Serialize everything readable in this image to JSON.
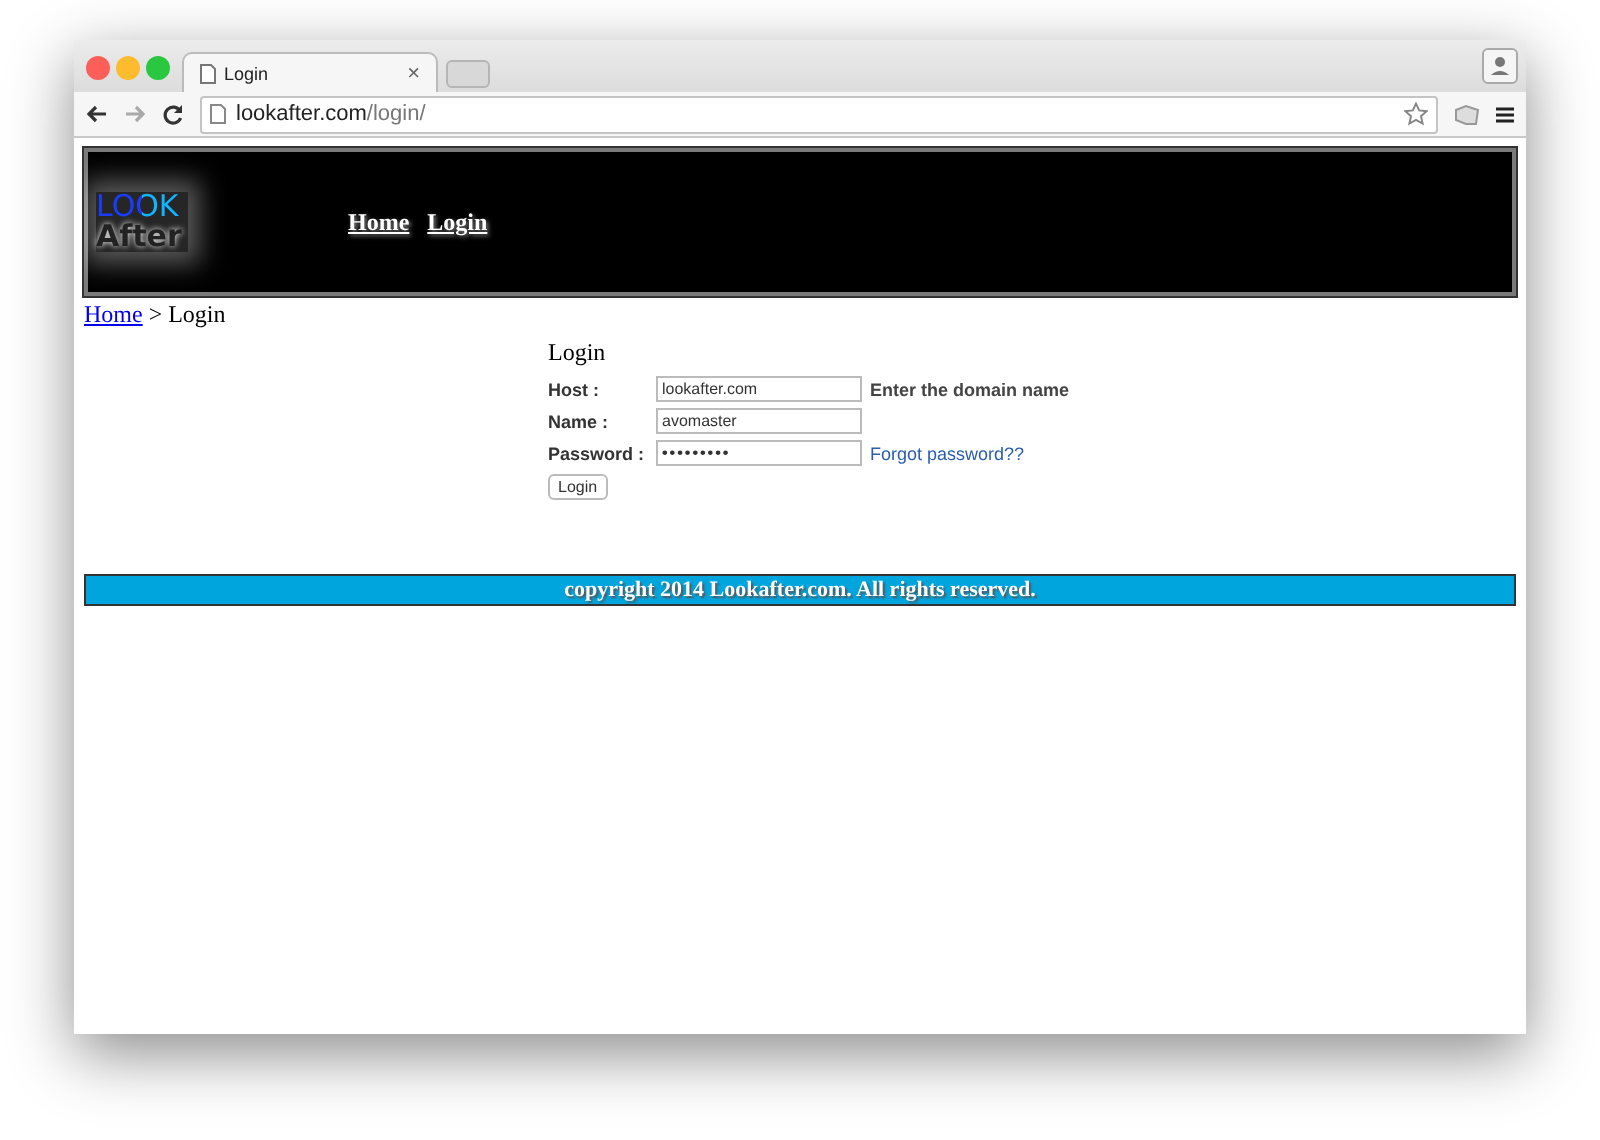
{
  "browser": {
    "tab": {
      "title": "Login",
      "close": "×"
    },
    "url": {
      "host": "lookafter.com",
      "path": "/login/"
    }
  },
  "header": {
    "logo": {
      "line1": "LOOK",
      "line2": "After"
    },
    "nav": [
      {
        "label": "Home"
      },
      {
        "label": "Login"
      }
    ]
  },
  "breadcrumb": {
    "link": "Home",
    "separator": ">",
    "current": "Login"
  },
  "form": {
    "title": "Login",
    "fields": [
      {
        "kind": "text",
        "label": "Host :",
        "value": "lookafter.com",
        "hint": "Enter the domain name"
      },
      {
        "kind": "text",
        "label": "Name :",
        "value": "avomaster"
      },
      {
        "kind": "password",
        "label": "Password :",
        "value": "•••••••••",
        "link": "Forgot password??"
      }
    ],
    "button": "Login"
  },
  "footer": {
    "text": "copyright 2014 Lookafter.com. All rights reserved."
  }
}
